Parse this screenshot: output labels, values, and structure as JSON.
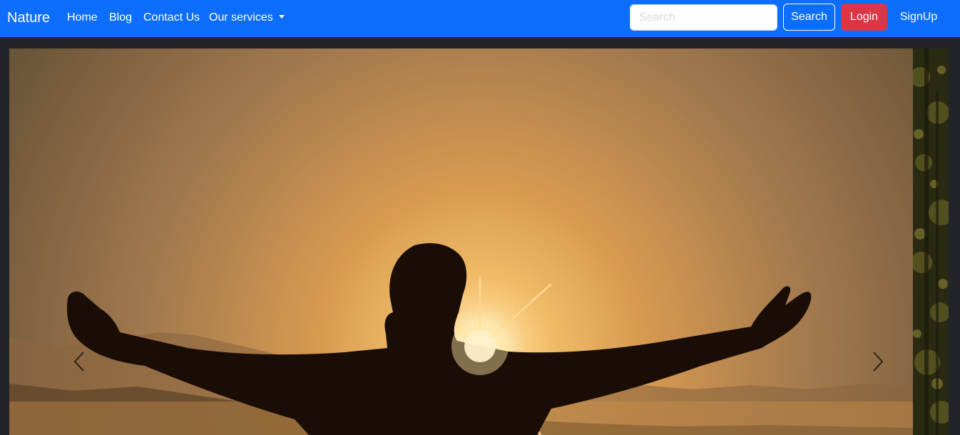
{
  "navbar": {
    "brand": "Nature",
    "links": [
      "Home",
      "Blog",
      "Contact Us"
    ],
    "dropdown_label": "Our services",
    "search_placeholder": "Search",
    "search_button": "Search",
    "login_button": "Login",
    "signup_button": "SignUp"
  },
  "colors": {
    "navbar": "#0d6efd",
    "login": "#dc3545",
    "page_bg": "#212529"
  },
  "carousel": {
    "prev_icon": "chevron-left-icon",
    "next_icon": "chevron-right-icon"
  }
}
